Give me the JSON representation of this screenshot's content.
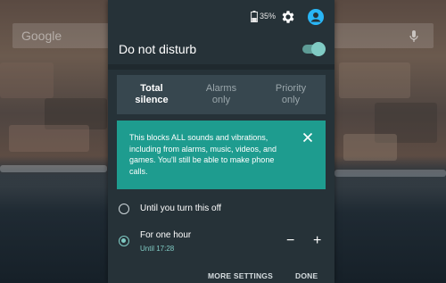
{
  "wallpaper": {
    "search_hint": "Google"
  },
  "status": {
    "battery": "35%"
  },
  "dnd": {
    "title": "Do not disturb",
    "enabled": true,
    "tabs": [
      {
        "label": "Total\nsilence",
        "active": true
      },
      {
        "label": "Alarms\nonly",
        "active": false
      },
      {
        "label": "Priority\nonly",
        "active": false
      }
    ],
    "info": "This blocks ALL sounds and vibrations, including from alarms, music, videos, and games. You'll still be able to make phone calls.",
    "options": [
      {
        "label": "Until you turn this off",
        "selected": false
      },
      {
        "label": "For one hour",
        "sub": "Until 17:28",
        "selected": true
      }
    ],
    "minus": "−",
    "plus": "+",
    "more_settings": "MORE SETTINGS",
    "done": "DONE"
  },
  "colors": {
    "panel": "#263238",
    "accent": "#80cbc4",
    "info_card": "#1e9c8f"
  }
}
